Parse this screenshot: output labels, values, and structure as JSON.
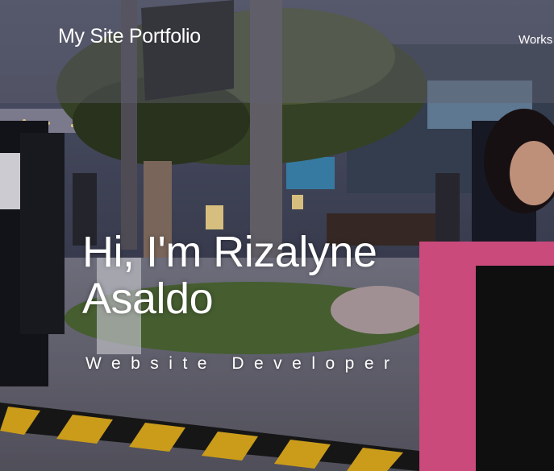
{
  "header": {
    "site_title": "My Site Portfolio",
    "nav_items": [
      "Works"
    ]
  },
  "hero": {
    "name": "Hi, I'm Rizalyne Asaldo",
    "role": "Website Developer",
    "background_image": "evening outdoor plaza with palm trees, lamps, people walking and a smiling woman covering her mouth on the right"
  },
  "colors": {
    "text": "#ffffff",
    "header_overlay": "rgba(95,95,110,0.45)"
  }
}
